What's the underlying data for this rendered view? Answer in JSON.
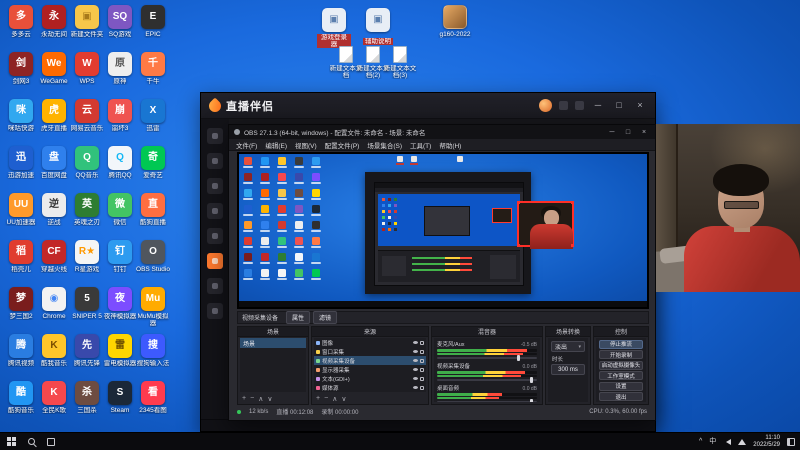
{
  "desktop": {
    "icons": [
      {
        "label": "多多云",
        "bg": "#e8503a",
        "glyph": "多"
      },
      {
        "label": "剑网3",
        "bg": "#8e2424",
        "glyph": "剑"
      },
      {
        "label": "咪咕快游",
        "bg": "#31a8f0",
        "glyph": "咪"
      },
      {
        "label": "迅游加速",
        "bg": "#1e5fd0",
        "glyph": "迅"
      },
      {
        "label": "UU加速器",
        "bg": "#ff9a2a",
        "glyph": "UU"
      },
      {
        "label": "稻壳儿",
        "bg": "#e03c2f",
        "glyph": "稻"
      },
      {
        "label": "梦三国2",
        "bg": "#7a1d1d",
        "glyph": "梦"
      },
      {
        "label": "腾讯视频",
        "bg": "#2a7de1",
        "glyph": "腾"
      },
      {
        "label": "酷狗音乐",
        "bg": "#2196f3",
        "glyph": "酷"
      },
      {
        "label": "永劫无间",
        "bg": "#b02020",
        "glyph": "永"
      },
      {
        "label": "WeGame",
        "bg": "#ff6a00",
        "glyph": "We"
      },
      {
        "label": "虎牙直播",
        "bg": "#ffb300",
        "glyph": "虎"
      },
      {
        "label": "百度网盘",
        "bg": "#2f80ed",
        "glyph": "盘"
      },
      {
        "label": "逆战",
        "bg": "#ececec",
        "glyph": "逆",
        "fg": "#333333"
      },
      {
        "label": "穿越火线",
        "bg": "#c22828",
        "glyph": "CF"
      },
      {
        "label": "Chrome",
        "bg": "#f2f2f2",
        "glyph": "◉",
        "fg": "#4285f4"
      },
      {
        "label": "酷我音乐",
        "bg": "#ffc62a",
        "glyph": "K",
        "fg": "#7a4c00"
      },
      {
        "label": "全民K歌",
        "bg": "#f5484d",
        "glyph": "K"
      },
      {
        "label": "新建文件夹",
        "bg": "#f7c64a",
        "glyph": "▣",
        "fg": "#a8791a"
      },
      {
        "label": "WPS",
        "bg": "#e23c30",
        "glyph": "W"
      },
      {
        "label": "网易云音乐",
        "bg": "#d33a31",
        "glyph": "云"
      },
      {
        "label": "QQ音乐",
        "bg": "#31c27c",
        "glyph": "Q"
      },
      {
        "label": "英魂之刃",
        "bg": "#2e7d32",
        "glyph": "英"
      },
      {
        "label": "R星游戏",
        "bg": "#f5f5f5",
        "glyph": "R★",
        "fg": "#ff9900"
      },
      {
        "label": "SNIPER 5",
        "bg": "#3a3a3a",
        "glyph": "5"
      },
      {
        "label": "腾讯先锋",
        "bg": "#3949ab",
        "glyph": "先"
      },
      {
        "label": "三国杀",
        "bg": "#6d4c41",
        "glyph": "杀"
      },
      {
        "label": "SQ游戏",
        "bg": "#7e57c2",
        "glyph": "SQ"
      },
      {
        "label": "原神",
        "bg": "#eeeeee",
        "glyph": "原",
        "fg": "#555555"
      },
      {
        "label": "崩坏3",
        "bg": "#ef5350",
        "glyph": "崩"
      },
      {
        "label": "腾讯QQ",
        "bg": "#f2f6fa",
        "glyph": "Q",
        "fg": "#12b7f5"
      },
      {
        "label": "微信",
        "bg": "#43c463",
        "glyph": "微"
      },
      {
        "label": "钉钉",
        "bg": "#2d9bf0",
        "glyph": "钉"
      },
      {
        "label": "夜神模拟器",
        "bg": "#7c4dff",
        "glyph": "夜"
      },
      {
        "label": "雷电模拟器",
        "bg": "#ffd600",
        "glyph": "雷",
        "fg": "#6b4c00"
      },
      {
        "label": "Steam",
        "bg": "#1b2838",
        "glyph": "S"
      },
      {
        "label": "EPIC",
        "bg": "#2f2f2f",
        "glyph": "E"
      },
      {
        "label": "千牛",
        "bg": "#ff7a45",
        "glyph": "千"
      },
      {
        "label": "迅雷",
        "bg": "#1976d2",
        "glyph": "X"
      },
      {
        "label": "爱奇艺",
        "bg": "#00c853",
        "glyph": "奇"
      },
      {
        "label": "酷狗直播",
        "bg": "#ff6e40",
        "glyph": "直"
      },
      {
        "label": "OBS Studio",
        "bg": "#50565e",
        "glyph": "O"
      },
      {
        "label": "MuMu模拟器",
        "bg": "#ffab00",
        "glyph": "Mu"
      },
      {
        "label": "搜狗输入法",
        "bg": "#3d5afe",
        "glyph": "搜"
      },
      {
        "label": "2345看图",
        "bg": "#ff3b4e",
        "glyph": "看"
      }
    ],
    "top_shortcuts": [
      {
        "label": "游戏登录器",
        "labelBg": "#b03030"
      },
      {
        "label": "辅助说明",
        "labelBg": "#b03030"
      },
      {
        "label": "g160-2022",
        "kind": "image"
      }
    ],
    "text_files": [
      {
        "label": "新建文本文档"
      },
      {
        "label": "新建文本文档(2)"
      },
      {
        "label": "新建文本文档(3)"
      }
    ]
  },
  "companion": {
    "title": "直播伴侣",
    "window_controls": {
      "min": "─",
      "max": "□",
      "close": "×"
    }
  },
  "obs": {
    "title": "OBS 27.1.3 (64-bit, windows) - 配置文件: 未命名 - 场景: 未命名",
    "menu": [
      "文件(F)",
      "编辑(E)",
      "视图(V)",
      "配置文件(P)",
      "场景集合(S)",
      "工具(T)",
      "帮助(H)"
    ],
    "window_controls": {
      "min": "─",
      "max": "□",
      "close": "×"
    },
    "source_toolbar": {
      "selected": "视频采集设备",
      "buttons": [
        "属性",
        "滤镜"
      ]
    },
    "docks": {
      "scenes": {
        "title": "场景",
        "items": [
          "场景"
        ]
      },
      "sources": {
        "title": "来源",
        "items": [
          {
            "name": "图像",
            "color": "#8ab4f8"
          },
          {
            "name": "窗口采集",
            "color": "#f8d04a"
          },
          {
            "name": "视频采集设备",
            "color": "#7bd88f",
            "selected": true
          },
          {
            "name": "显示器采集",
            "color": "#f49d6e"
          },
          {
            "name": "文本(GDI+)",
            "color": "#c792ea"
          },
          {
            "name": "媒体源",
            "color": "#f06292"
          }
        ]
      },
      "mixer": {
        "title": "混音器",
        "channels": [
          {
            "name": "麦克风/Aux",
            "db": "-0.5 dB",
            "level": 0.9,
            "slider": 0.82
          },
          {
            "name": "视频采集设备",
            "db": "0.0 dB",
            "level": 0.88,
            "slider": 0.95
          },
          {
            "name": "桌面音频",
            "db": "0.0 dB",
            "level": 0.65,
            "slider": 0.95
          }
        ]
      },
      "transitions": {
        "title": "场景转换",
        "value": "淡出",
        "duration_label": "时长",
        "duration": "300 ms"
      },
      "controls": {
        "title": "控制",
        "buttons": [
          "停止推流",
          "开始录制",
          "启动虚拟摄像头",
          "工作室模式",
          "设置",
          "退出"
        ]
      }
    },
    "status": {
      "bitrate": "12 kb/s",
      "live": "直播 00:12:08",
      "rec": "录制 00:00:00",
      "cpu": "CPU: 0.3%, 60.00 fps"
    }
  },
  "taskbar": {
    "time": "11:10",
    "date": "2022/5/29"
  }
}
